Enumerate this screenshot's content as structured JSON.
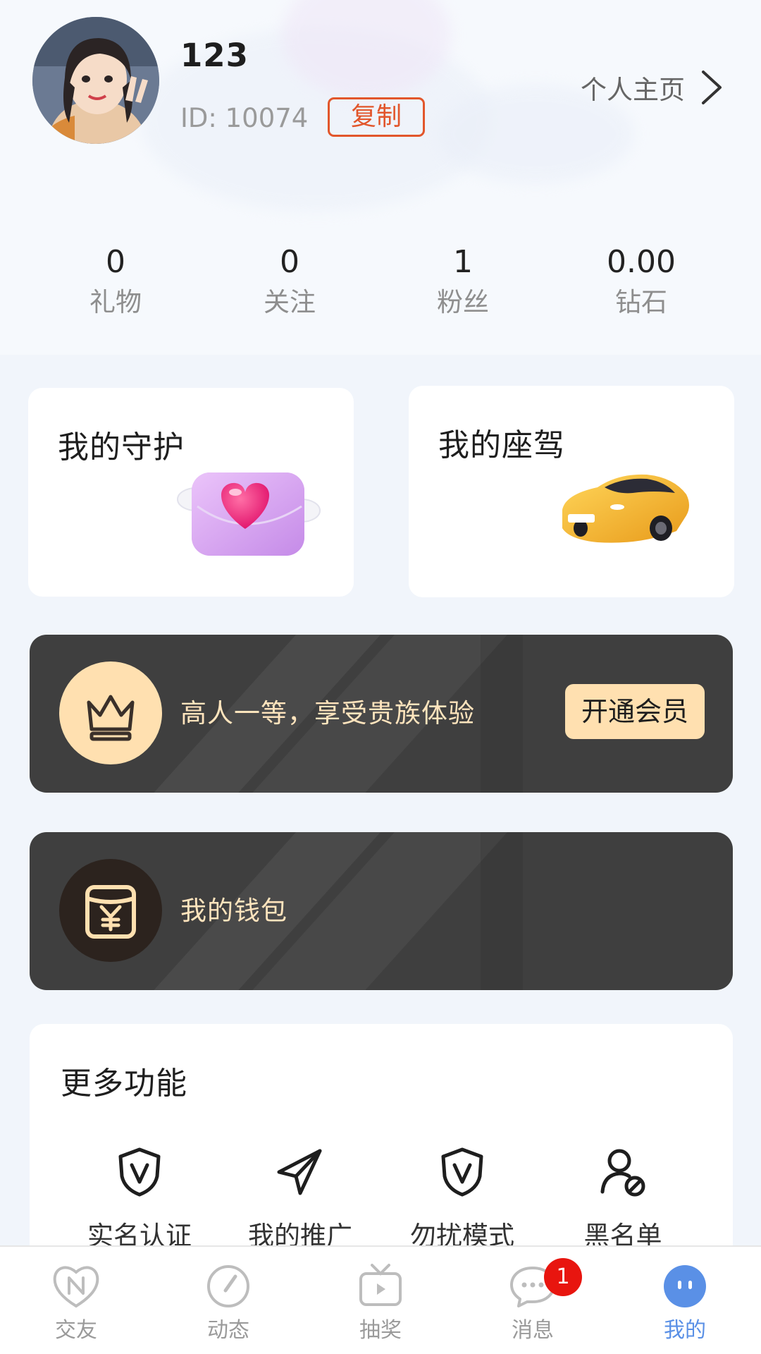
{
  "profile": {
    "username": "123",
    "id_text": "ID:  10074",
    "copy_label": "复制",
    "homepage_link": "个人主页"
  },
  "stats": [
    {
      "value": "0",
      "label": "礼物"
    },
    {
      "value": "0",
      "label": "关注"
    },
    {
      "value": "1",
      "label": "粉丝"
    },
    {
      "value": "0.00",
      "label": "钻石"
    }
  ],
  "cards": {
    "guard_title": "我的守护",
    "car_title": "我的座驾"
  },
  "vip_banner": {
    "text": "高人一等，享受贵族体验",
    "button_label": "开通会员"
  },
  "wallet_banner": {
    "text": "我的钱包"
  },
  "more": {
    "title": "更多功能",
    "items": [
      {
        "label": "实名认证",
        "icon": "shield-v-icon"
      },
      {
        "label": "我的推广",
        "icon": "paper-plane-icon"
      },
      {
        "label": "勿扰模式",
        "icon": "shield-v-icon"
      },
      {
        "label": "黑名单",
        "icon": "user-block-icon"
      }
    ]
  },
  "tabbar": {
    "items": [
      {
        "label": "交友",
        "icon": "heart-n-icon"
      },
      {
        "label": "动态",
        "icon": "compass-icon"
      },
      {
        "label": "抽奖",
        "icon": "tv-play-icon"
      },
      {
        "label": "消息",
        "icon": "chat-bubble-icon",
        "badge": "1"
      },
      {
        "label": "我的",
        "icon": "face-icon"
      }
    ],
    "active_index": 4
  },
  "colors": {
    "accent_orange": "#E2562B",
    "gold": "#FFE0B0",
    "banner_dark": "#3F3F3F",
    "tab_active": "#5A90E6",
    "badge_red": "#E8150F"
  }
}
